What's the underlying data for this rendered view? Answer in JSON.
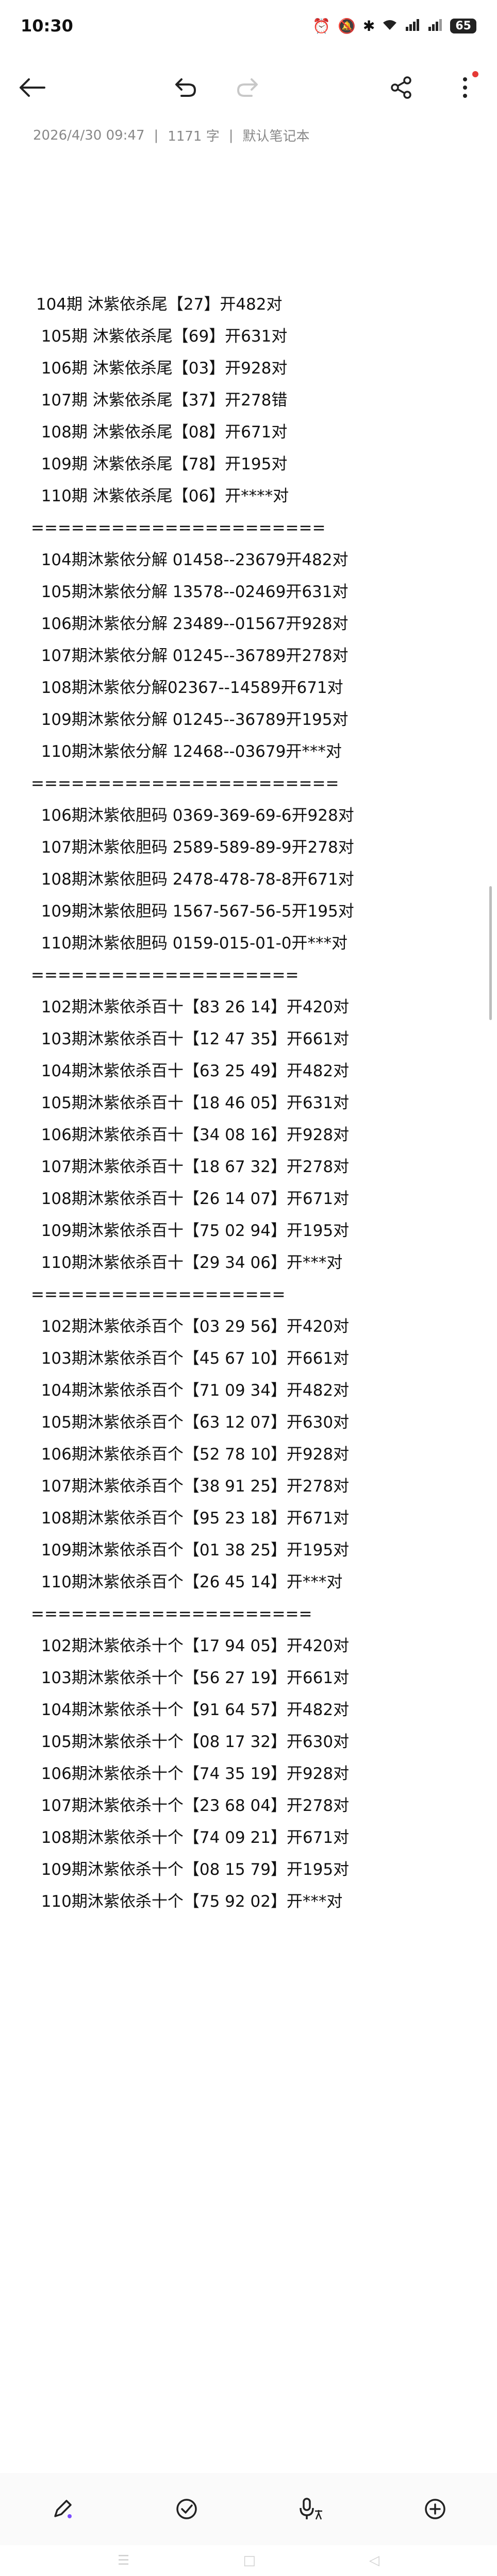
{
  "status": {
    "time": "10:30",
    "battery": "65"
  },
  "meta": {
    "date": "2026/4/30 09:47",
    "sep": "|",
    "words": "1171 字",
    "notebook": "默认笔记本"
  },
  "note_lines": [
    " 104期 沐紫依杀尾【27】开482对",
    "  105期 沐紫依杀尾【69】开631对",
    "  106期 沐紫依杀尾【03】开928对",
    "  107期 沐紫依杀尾【37】开278错",
    "  108期 沐紫依杀尾【08】开671对",
    "  109期 沐紫依杀尾【78】开195对",
    "  110期 沐紫依杀尾【06】开****对",
    "======================",
    "  104期沐紫依分解 01458--23679开482对",
    "  105期沐紫依分解 13578--02469开631对",
    "  106期沐紫依分解 23489--01567开928对",
    "  107期沐紫依分解 01245--36789开278对",
    "  108期沐紫依分解02367--14589开671对",
    "  109期沐紫依分解 01245--36789开195对",
    "  110期沐紫依分解 12468--03679开***对",
    "=======================",
    "  106期沐紫依胆码 0369-369-69-6开928对",
    "  107期沐紫依胆码 2589-589-89-9开278对",
    "  108期沐紫依胆码 2478-478-78-8开671对",
    "  109期沐紫依胆码 1567-567-56-5开195对",
    "  110期沐紫依胆码 0159-015-01-0开***对",
    "====================",
    "  102期沐紫依杀百十【83 26 14】开420对",
    "  103期沐紫依杀百十【12 47 35】开661对",
    "  104期沐紫依杀百十【63 25 49】开482对",
    "  105期沐紫依杀百十【18 46 05】开631对",
    "  106期沐紫依杀百十【34 08 16】开928对",
    "  107期沐紫依杀百十【18 67 32】开278对",
    "  108期沐紫依杀百十【26 14 07】开671对",
    "  109期沐紫依杀百十【75 02 94】开195对",
    "  110期沐紫依杀百十【29 34 06】开***对",
    "===================",
    "  102期沐紫依杀百个【03 29 56】开420对",
    "  103期沐紫依杀百个【45 67 10】开661对",
    "  104期沐紫依杀百个【71 09 34】开482对",
    "  105期沐紫依杀百个【63 12 07】开630对",
    "  106期沐紫依杀百个【52 78 10】开928对",
    "  107期沐紫依杀百个【38 91 25】开278对",
    "  108期沐紫依杀百个【95 23 18】开671对",
    "  109期沐紫依杀百个【01 38 25】开195对",
    "  110期沐紫依杀百个【26 45 14】开***对",
    "=====================",
    "  102期沐紫依杀十个【17 94 05】开420对",
    "  103期沐紫依杀十个【56 27 19】开661对",
    "  104期沐紫依杀十个【91 64 57】开482对",
    "  105期沐紫依杀十个【08 17 32】开630对",
    "  106期沐紫依杀十个【74 35 19】开928对",
    "  107期沐紫依杀十个【23 68 04】开278对",
    "  108期沐紫依杀十个【74 09 21】开671对",
    "  109期沐紫依杀十个【08 15 79】开195对",
    "  110期沐紫依杀十个【75 92 02】开***对"
  ]
}
